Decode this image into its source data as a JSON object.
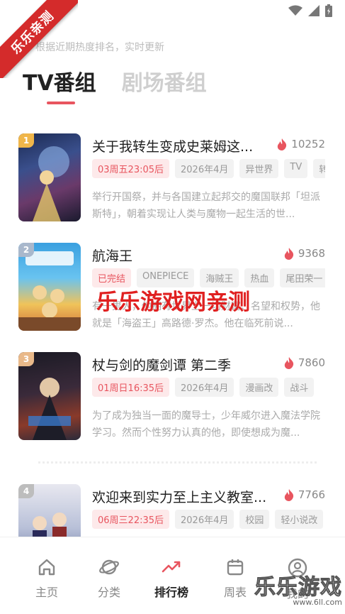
{
  "watermark_ribbon": "乐乐亲测",
  "hint_text": "根据近期热度排名，实时更新",
  "tabs": [
    {
      "label": "TV番组",
      "active": true
    },
    {
      "label": "剧场番组",
      "active": false
    }
  ],
  "items": [
    {
      "rank": "1",
      "rank_color": "#f0b64a",
      "title": "关于我转生变成史莱姆这...",
      "heat": "10252",
      "tags": [
        "03周五23:05后",
        "2026年4月",
        "异世界",
        "TV",
        "转"
      ],
      "desc": "举行开国祭，并与各国建立起邦交的魔国联邦「坦派斯特」，朝着实现让人类与魔物一起生活的世..."
    },
    {
      "rank": "2",
      "rank_color": "#a9b8cc",
      "title": "航海王",
      "heat": "9368",
      "tags": [
        "已完结",
        "ONEPIECE",
        "海贼王",
        "热血",
        "尾田荣一"
      ],
      "desc": "有一男人，他拥有世界上一切财富、名望和权势，他就是「海盗王」高路德·罗杰。他在临死前说..."
    },
    {
      "rank": "3",
      "rank_color": "#e9b98a",
      "title": "杖与剑的魔剑谭 第二季",
      "heat": "7860",
      "tags": [
        "01周日16:35后",
        "2026年4月",
        "漫画改",
        "战斗"
      ],
      "desc": "为了成为独当一面的魔导士，少年威尔进入魔法学院学习。然而个性努力认真的他，即使想成为魔..."
    },
    {
      "rank": "4",
      "rank_color": "#bdbdbd",
      "title": "欢迎来到实力至上主义教室...",
      "heat": "7766",
      "tags": [
        "06周三22:35后",
        "2026年4月",
        "校园",
        "轻小说改"
      ],
      "desc": ""
    }
  ],
  "center_watermark": "乐乐游戏网亲测",
  "nav": [
    {
      "label": "主页",
      "icon": "home-icon",
      "active": false
    },
    {
      "label": "分类",
      "icon": "planet-icon",
      "active": false
    },
    {
      "label": "排行榜",
      "icon": "trending-icon",
      "active": true
    },
    {
      "label": "周表",
      "icon": "calendar-icon",
      "active": false
    },
    {
      "label": "我的",
      "icon": "profile-icon",
      "active": false
    }
  ],
  "brand_watermark": {
    "big": "乐乐游戏",
    "small": "www.6ll.com"
  },
  "colors": {
    "accent": "#e8555f",
    "active_nav": "#e8555f"
  }
}
